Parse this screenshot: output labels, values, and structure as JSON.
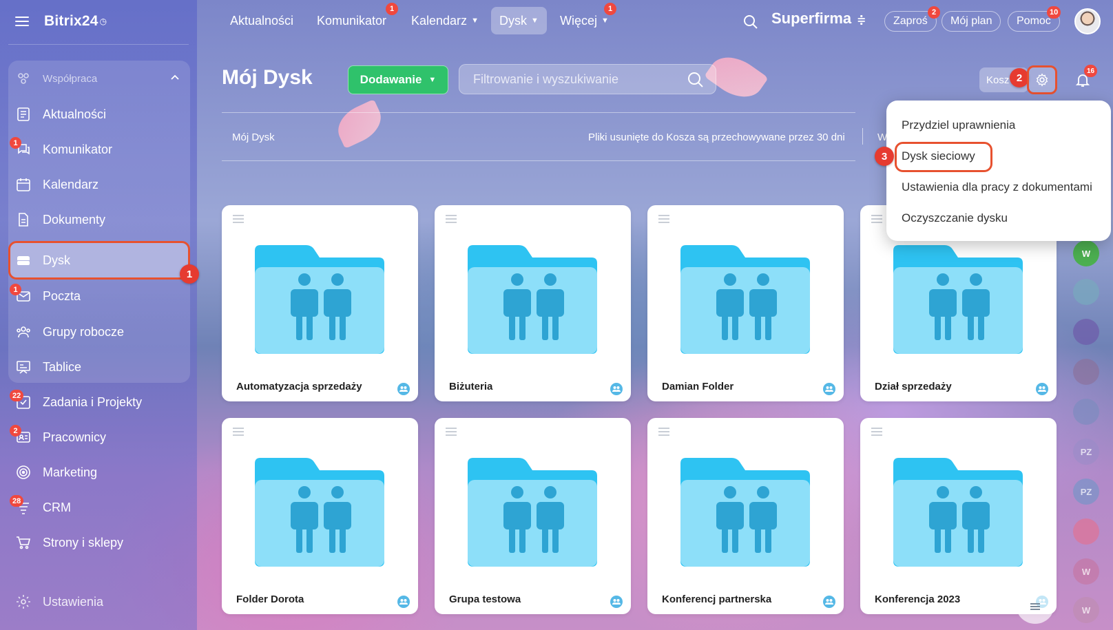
{
  "brand": {
    "name": "Bitrix24",
    "clock": "◷"
  },
  "sidebar": {
    "group_title": "Współpraca",
    "items": [
      {
        "label": "Aktualności",
        "badge": ""
      },
      {
        "label": "Komunikator",
        "badge": "1"
      },
      {
        "label": "Kalendarz",
        "badge": ""
      },
      {
        "label": "Dokumenty",
        "badge": ""
      },
      {
        "label": "Dysk",
        "badge": ""
      },
      {
        "label": "Poczta",
        "badge": "1"
      },
      {
        "label": "Grupy robocze",
        "badge": ""
      },
      {
        "label": "Tablice",
        "badge": ""
      },
      {
        "label": "Zadania i Projekty",
        "badge": "22"
      },
      {
        "label": "Pracownicy",
        "badge": "2"
      },
      {
        "label": "Marketing",
        "badge": ""
      },
      {
        "label": "CRM",
        "badge": "28"
      },
      {
        "label": "Strony i sklepy",
        "badge": ""
      },
      {
        "label": "Ustawienia",
        "badge": ""
      }
    ]
  },
  "topnav": {
    "items": [
      {
        "label": "Aktualności",
        "badge": ""
      },
      {
        "label": "Komunikator",
        "badge": "1"
      },
      {
        "label": "Kalendarz",
        "badge": ""
      },
      {
        "label": "Dysk",
        "badge": ""
      },
      {
        "label": "Więcej",
        "badge": "1"
      }
    ],
    "company": "Superfirma",
    "invite": {
      "label": "Zaproś",
      "badge": "2"
    },
    "plan": "Mój plan",
    "help": {
      "label": "Pomoc",
      "badge": "10"
    }
  },
  "header": {
    "title": "Mój Dysk",
    "add_label": "Dodawanie",
    "search_placeholder": "Filtrowanie i wyszukiwanie",
    "trash_label": "Kosz",
    "bell_badge": "16"
  },
  "breadcrumb": "Mój Dysk",
  "trash_note": "Pliki usunięte do Kosza są przechowywane przez 30 dni",
  "trash_note_more": "W",
  "menu": {
    "items": [
      "Przydziel uprawnienia",
      "Dysk sieciowy",
      "Ustawienia dla pracy z dokumentami",
      "Oczyszczanie dysku"
    ]
  },
  "steps": [
    "1",
    "2",
    "3"
  ],
  "folders": [
    "Automatyzacja sprzedaży",
    "Biżuteria",
    "Damian Folder",
    "Dział sprzedaży",
    "Folder Dorota",
    "Grupa testowa",
    "Konferencj partnerska",
    "Konferencja 2023"
  ],
  "rail": [
    "W",
    "PZ",
    "PZ",
    "W",
    "W"
  ],
  "colors": {
    "accent_green": "#2fc26b",
    "highlight": "#e7512f",
    "badge_red": "#f0483e",
    "folder_blue": "#4fc3f7"
  }
}
